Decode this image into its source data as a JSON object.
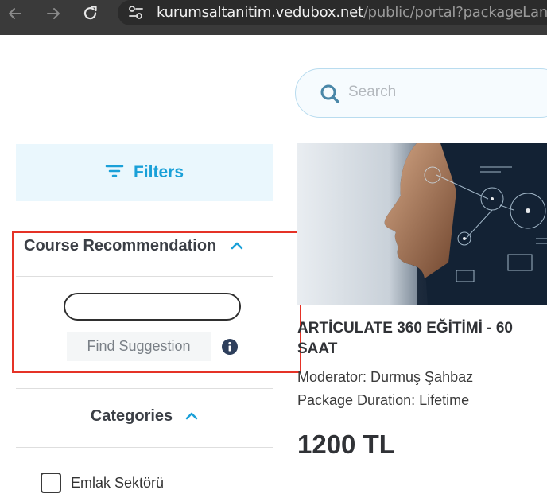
{
  "browser": {
    "url_host": "kurumsaltanitim.vedubox.net",
    "url_path": "/public/portal?packageLang"
  },
  "search": {
    "placeholder": "Search"
  },
  "filters": {
    "label": "Filters"
  },
  "course_recommendation": {
    "title": "Course Recommendation",
    "input_value": "",
    "find_button": "Find Suggestion"
  },
  "categories": {
    "title": "Categories",
    "items": [
      {
        "label": "Emlak Sektörü",
        "checked": false
      }
    ]
  },
  "course": {
    "title": "ARTİCULATE 360 EĞİTİMİ - 60 SAAT",
    "moderator": "Moderator: Durmuş Şahbaz",
    "duration": "Package Duration: Lifetime",
    "price": "1200 TL"
  },
  "colors": {
    "accent": "#1aa0d8",
    "highlight": "#e53226",
    "filters_bg": "#eaf7fd"
  },
  "icons": [
    "back-icon",
    "forward-icon",
    "reload-icon",
    "site-settings-icon",
    "search-icon",
    "filter-icon",
    "chevron-up-icon",
    "info-icon"
  ]
}
